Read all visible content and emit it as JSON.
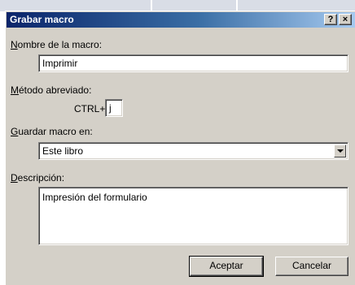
{
  "dialog": {
    "title": "Grabar macro",
    "help_button": "?",
    "close_button": "×"
  },
  "macro_name": {
    "label_accel": "N",
    "label_rest": "ombre de la macro:",
    "value": "Imprimir"
  },
  "shortcut": {
    "label_accel": "M",
    "label_rest": "étodo abreviado:",
    "prefix": "CTRL+",
    "value": "j"
  },
  "store_in": {
    "label_accel": "G",
    "label_rest": "uardar macro en:",
    "value": "Este libro"
  },
  "description": {
    "label_accel": "D",
    "label_rest": "escripción:",
    "value": "Impresión del formulario"
  },
  "buttons": {
    "ok": "Aceptar",
    "cancel": "Cancelar"
  },
  "icons": {
    "dropdown": "chevron-down-icon"
  }
}
